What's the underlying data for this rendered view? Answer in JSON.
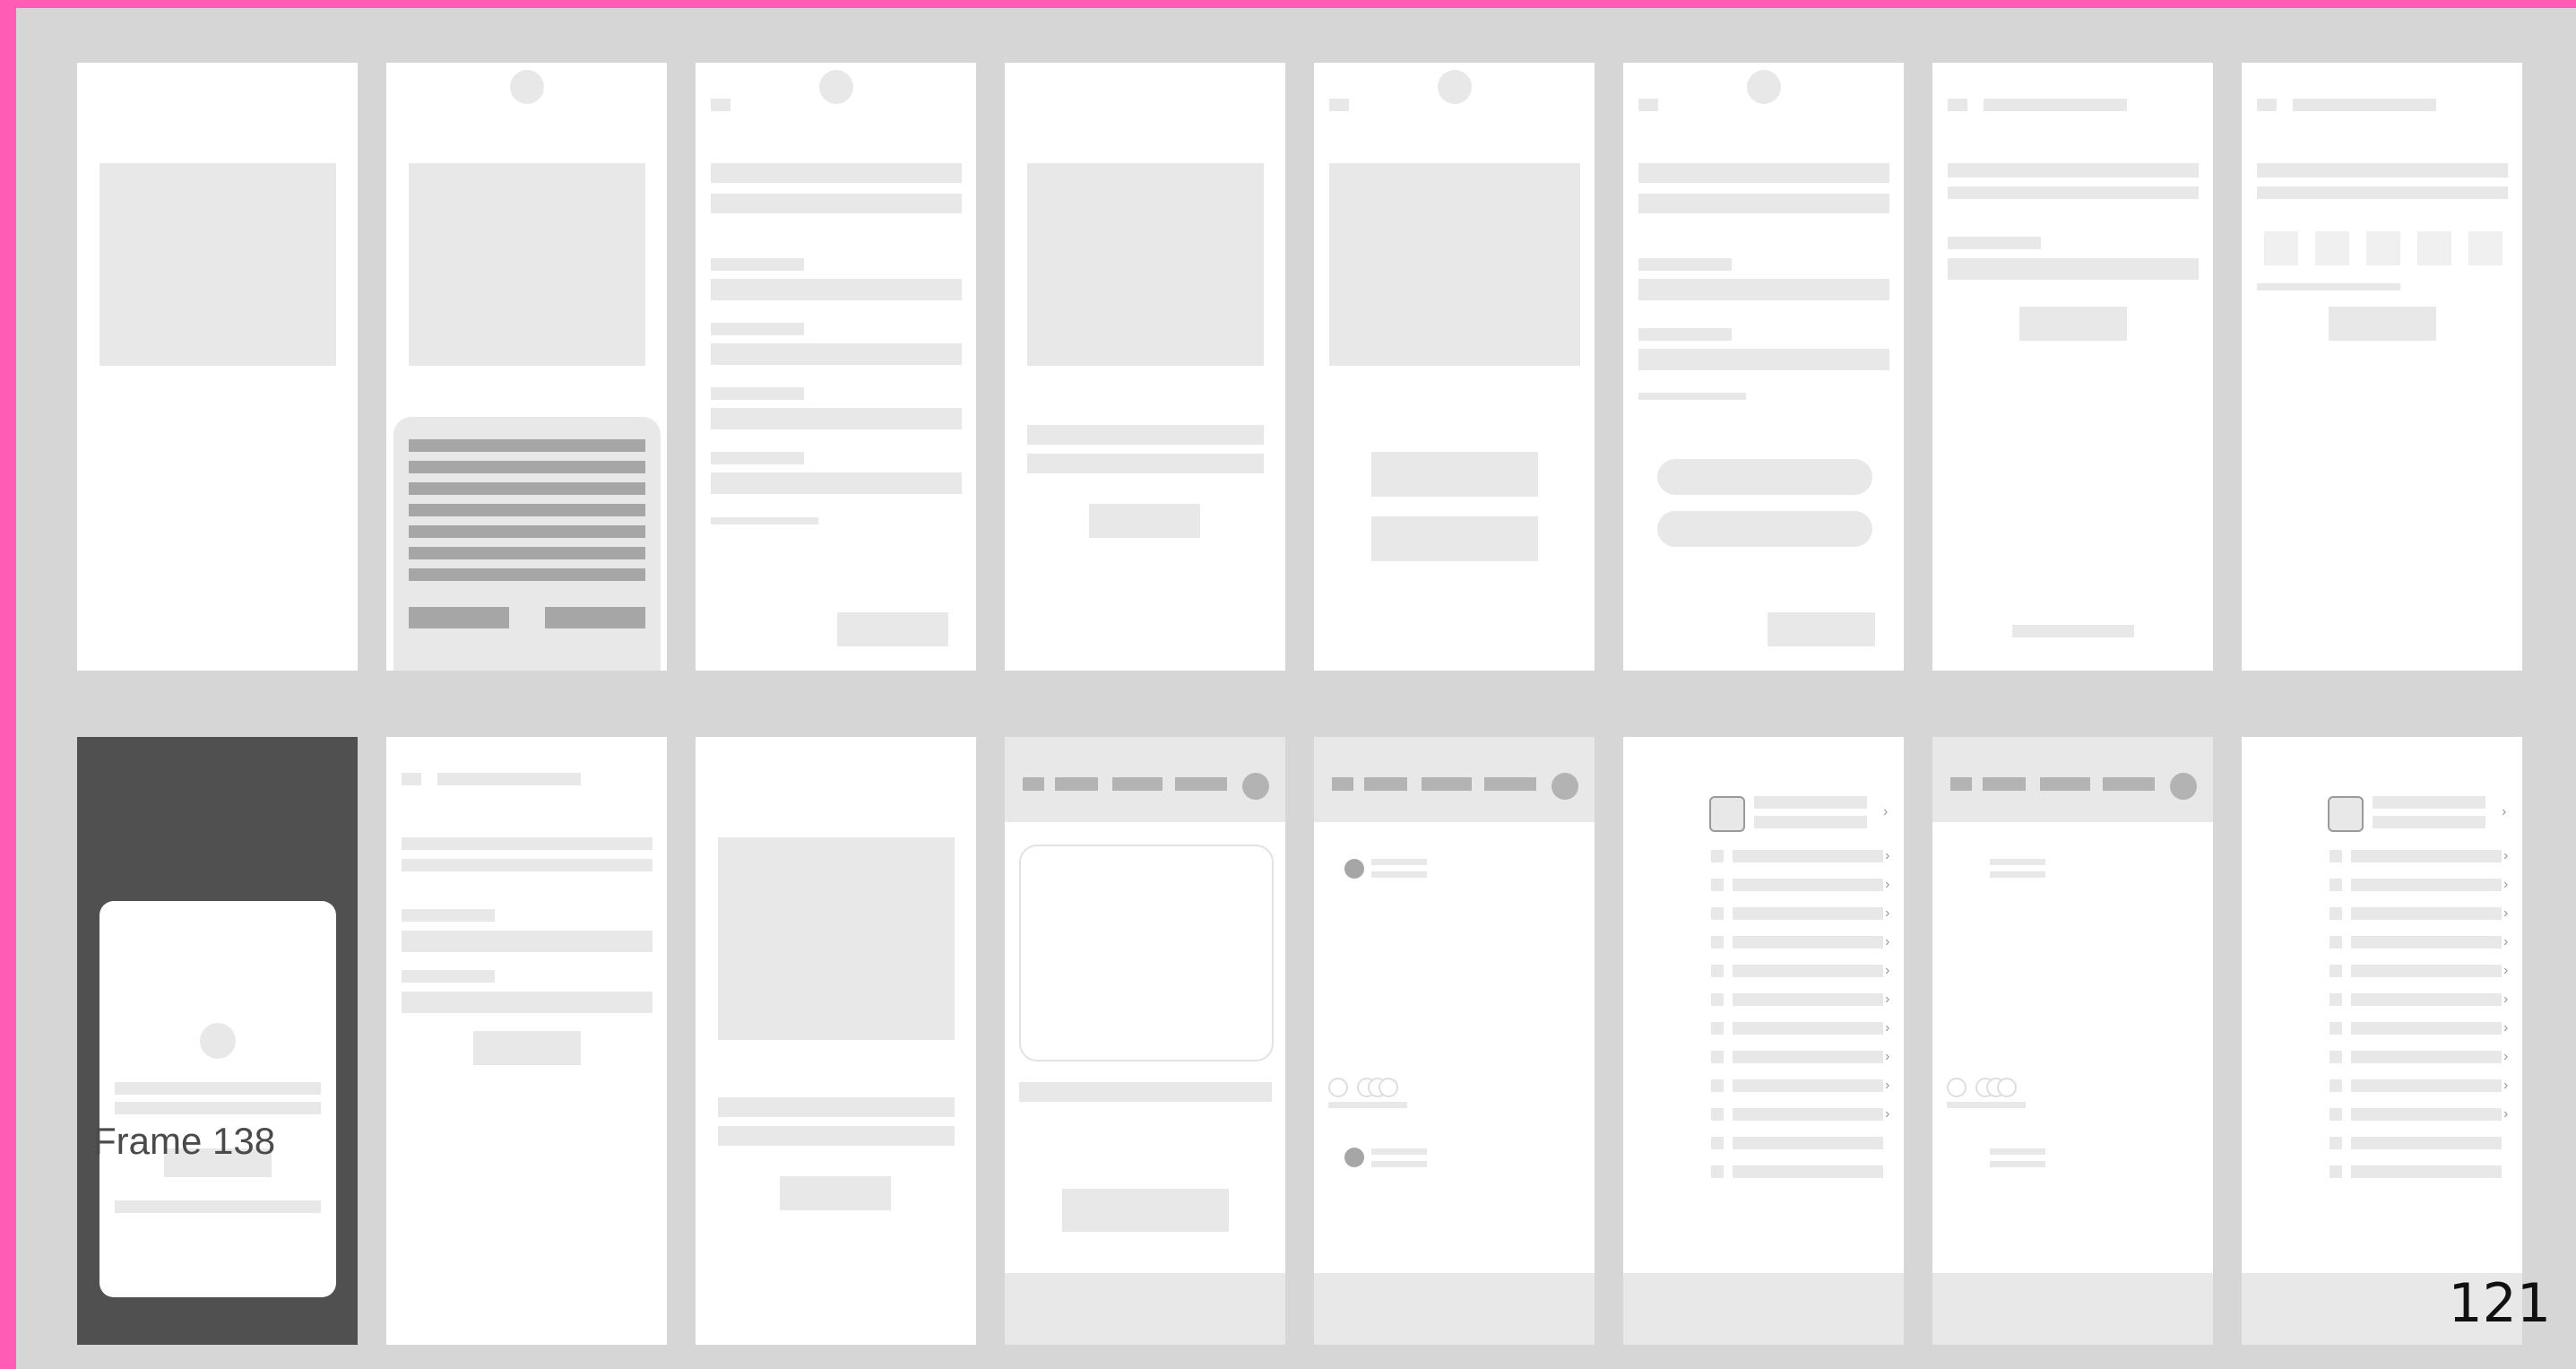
{
  "canvas": {
    "background_color": "#d6d6d6",
    "border_color": "#ff5cb5",
    "frame_label": "Frame 138",
    "page_number": "121"
  },
  "rows": [
    {
      "frames": [
        "splash-screen",
        "terms-sheet",
        "signup-form",
        "intro-screen",
        "auth-choice",
        "login-form",
        "verify-email",
        "verification-code"
      ]
    },
    {
      "frames": [
        "permission-modal",
        "reset-password",
        "success-screen",
        "home-feed-empty",
        "messages-feed",
        "settings-list",
        "messages-feed-alt",
        "settings-list-alt"
      ]
    }
  ],
  "colors": {
    "placeholder": "#e8e8e8",
    "accent_gray": "#a6a6a6",
    "dark_frame": "#505050"
  }
}
